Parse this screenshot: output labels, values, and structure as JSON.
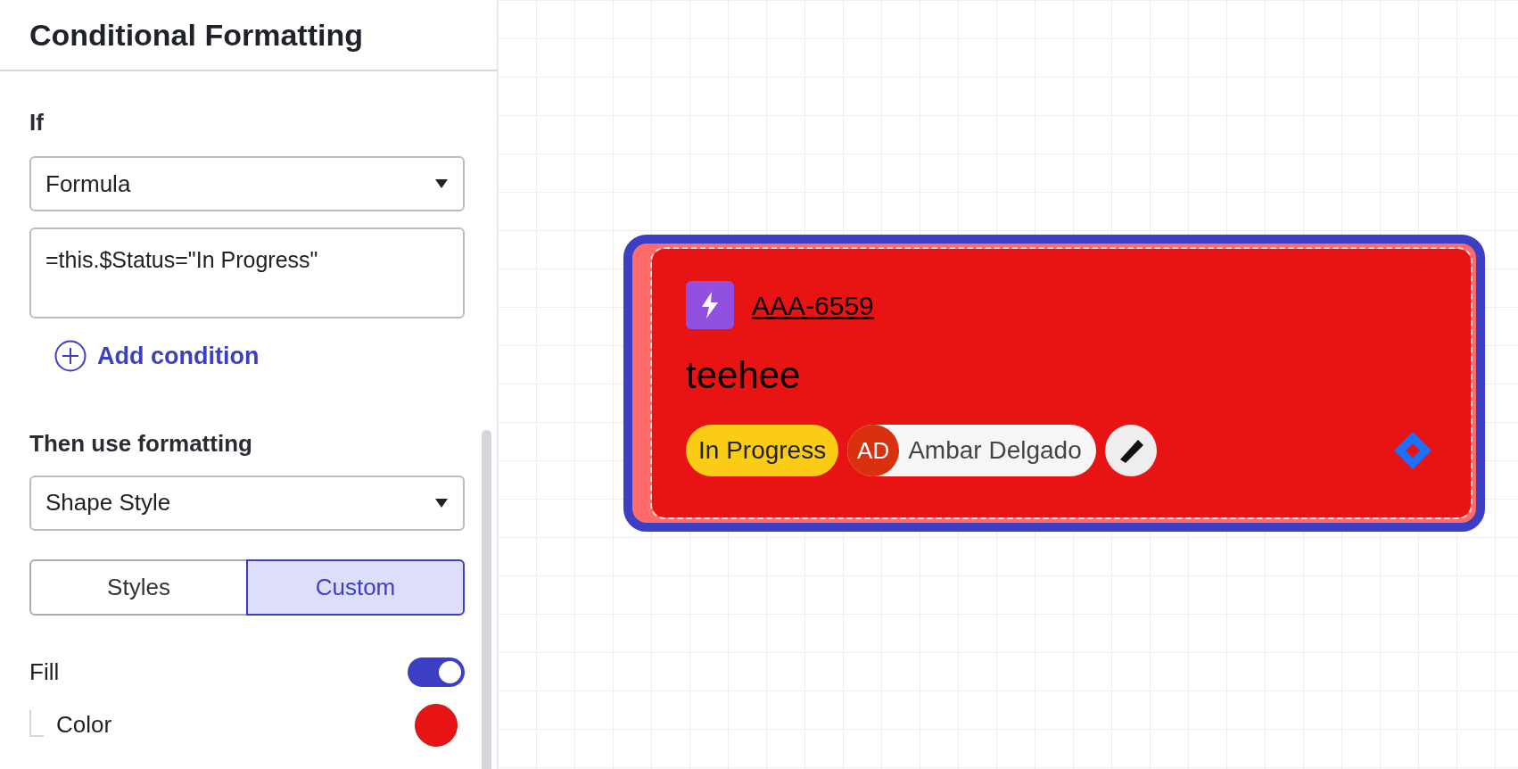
{
  "panel": {
    "title": "Conditional Formatting",
    "if_label": "If",
    "condition_type": "Formula",
    "formula": "=this.$Status=\"In Progress\"",
    "add_condition": "Add condition",
    "then_label": "Then use formatting",
    "format_type": "Shape Style",
    "segments": [
      {
        "label": "Styles",
        "selected": false
      },
      {
        "label": "Custom",
        "selected": true
      }
    ],
    "fill": {
      "label": "Fill",
      "on": true
    },
    "color": {
      "label": "Color",
      "color": "#e81313"
    }
  },
  "card": {
    "key": "AAA-6559",
    "title": "teehee",
    "status": {
      "label": "In Progress",
      "color": "#facc15"
    },
    "assignee": {
      "initials": "AD",
      "name": "Ambar Delgado"
    }
  }
}
